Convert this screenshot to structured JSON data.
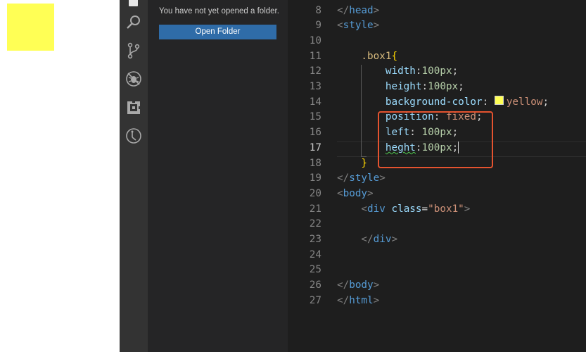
{
  "sidebar": {
    "message": "You have not yet opened a folder.",
    "open_folder_label": "Open Folder"
  },
  "activity_icons": [
    "explorer-icon",
    "search-icon",
    "source-control-icon",
    "debug-icon",
    "extensions-icon",
    "timeline-icon"
  ],
  "colors": {
    "preview_box": "#ffff55",
    "highlight_border": "#e5532f",
    "button": "#2f6ca8"
  },
  "editor": {
    "active_line": "17",
    "lines": [
      {
        "n": "8",
        "tokens": [
          {
            "t": "</",
            "c": "punct"
          },
          {
            "t": "head",
            "c": "tag"
          },
          {
            "t": ">",
            "c": "punct"
          }
        ]
      },
      {
        "n": "9",
        "tokens": [
          {
            "t": "<",
            "c": "punct"
          },
          {
            "t": "style",
            "c": "tag"
          },
          {
            "t": ">",
            "c": "punct"
          }
        ]
      },
      {
        "n": "10",
        "tokens": []
      },
      {
        "n": "11",
        "tokens": [
          {
            "t": "    .box1",
            "c": "sel"
          },
          {
            "t": "{",
            "c": "brace"
          }
        ]
      },
      {
        "n": "12",
        "tokens": [
          {
            "t": "        width",
            "c": "prop"
          },
          {
            "t": ":",
            "c": "plain"
          },
          {
            "t": "100px",
            "c": "num"
          },
          {
            "t": ";",
            "c": "plain"
          }
        ]
      },
      {
        "n": "13",
        "tokens": [
          {
            "t": "        height",
            "c": "prop"
          },
          {
            "t": ":",
            "c": "plain"
          },
          {
            "t": "100px",
            "c": "num"
          },
          {
            "t": ";",
            "c": "plain"
          }
        ]
      },
      {
        "n": "14",
        "tokens": [
          {
            "t": "        background-color",
            "c": "prop"
          },
          {
            "t": ": ",
            "c": "plain"
          },
          {
            "t": "",
            "c": "swatch"
          },
          {
            "t": "yellow",
            "c": "val"
          },
          {
            "t": ";",
            "c": "plain"
          }
        ]
      },
      {
        "n": "15",
        "tokens": [
          {
            "t": "        position",
            "c": "prop"
          },
          {
            "t": ": ",
            "c": "plain"
          },
          {
            "t": "fixed",
            "c": "val"
          },
          {
            "t": ";",
            "c": "plain"
          }
        ]
      },
      {
        "n": "16",
        "tokens": [
          {
            "t": "        left",
            "c": "prop"
          },
          {
            "t": ": ",
            "c": "plain"
          },
          {
            "t": "100px",
            "c": "num"
          },
          {
            "t": ";",
            "c": "plain"
          }
        ]
      },
      {
        "n": "17",
        "tokens": [
          {
            "t": "        ",
            "c": "plain"
          },
          {
            "t": "heght",
            "c": "prop squiggle"
          },
          {
            "t": ":",
            "c": "plain"
          },
          {
            "t": "100px",
            "c": "num"
          },
          {
            "t": ";",
            "c": "plain"
          },
          {
            "t": "",
            "c": "caret"
          }
        ]
      },
      {
        "n": "18",
        "tokens": [
          {
            "t": "    }",
            "c": "brace"
          }
        ]
      },
      {
        "n": "19",
        "tokens": [
          {
            "t": "</",
            "c": "punct"
          },
          {
            "t": "style",
            "c": "tag"
          },
          {
            "t": ">",
            "c": "punct"
          }
        ]
      },
      {
        "n": "20",
        "tokens": [
          {
            "t": "<",
            "c": "punct"
          },
          {
            "t": "body",
            "c": "tag"
          },
          {
            "t": ">",
            "c": "punct"
          }
        ]
      },
      {
        "n": "21",
        "tokens": [
          {
            "t": "    <",
            "c": "punct"
          },
          {
            "t": "div",
            "c": "tag"
          },
          {
            "t": " class",
            "c": "attr"
          },
          {
            "t": "=",
            "c": "plain"
          },
          {
            "t": "\"box1\"",
            "c": "str"
          },
          {
            "t": ">",
            "c": "punct"
          }
        ]
      },
      {
        "n": "22",
        "tokens": []
      },
      {
        "n": "23",
        "tokens": [
          {
            "t": "    </",
            "c": "punct"
          },
          {
            "t": "div",
            "c": "tag"
          },
          {
            "t": ">",
            "c": "punct"
          }
        ]
      },
      {
        "n": "24",
        "tokens": []
      },
      {
        "n": "25",
        "tokens": []
      },
      {
        "n": "26",
        "tokens": [
          {
            "t": "</",
            "c": "punct"
          },
          {
            "t": "body",
            "c": "tag"
          },
          {
            "t": ">",
            "c": "punct"
          }
        ]
      },
      {
        "n": "27",
        "tokens": [
          {
            "t": "</",
            "c": "punct"
          },
          {
            "t": "html",
            "c": "tag"
          },
          {
            "t": ">",
            "c": "punct"
          }
        ]
      }
    ]
  }
}
